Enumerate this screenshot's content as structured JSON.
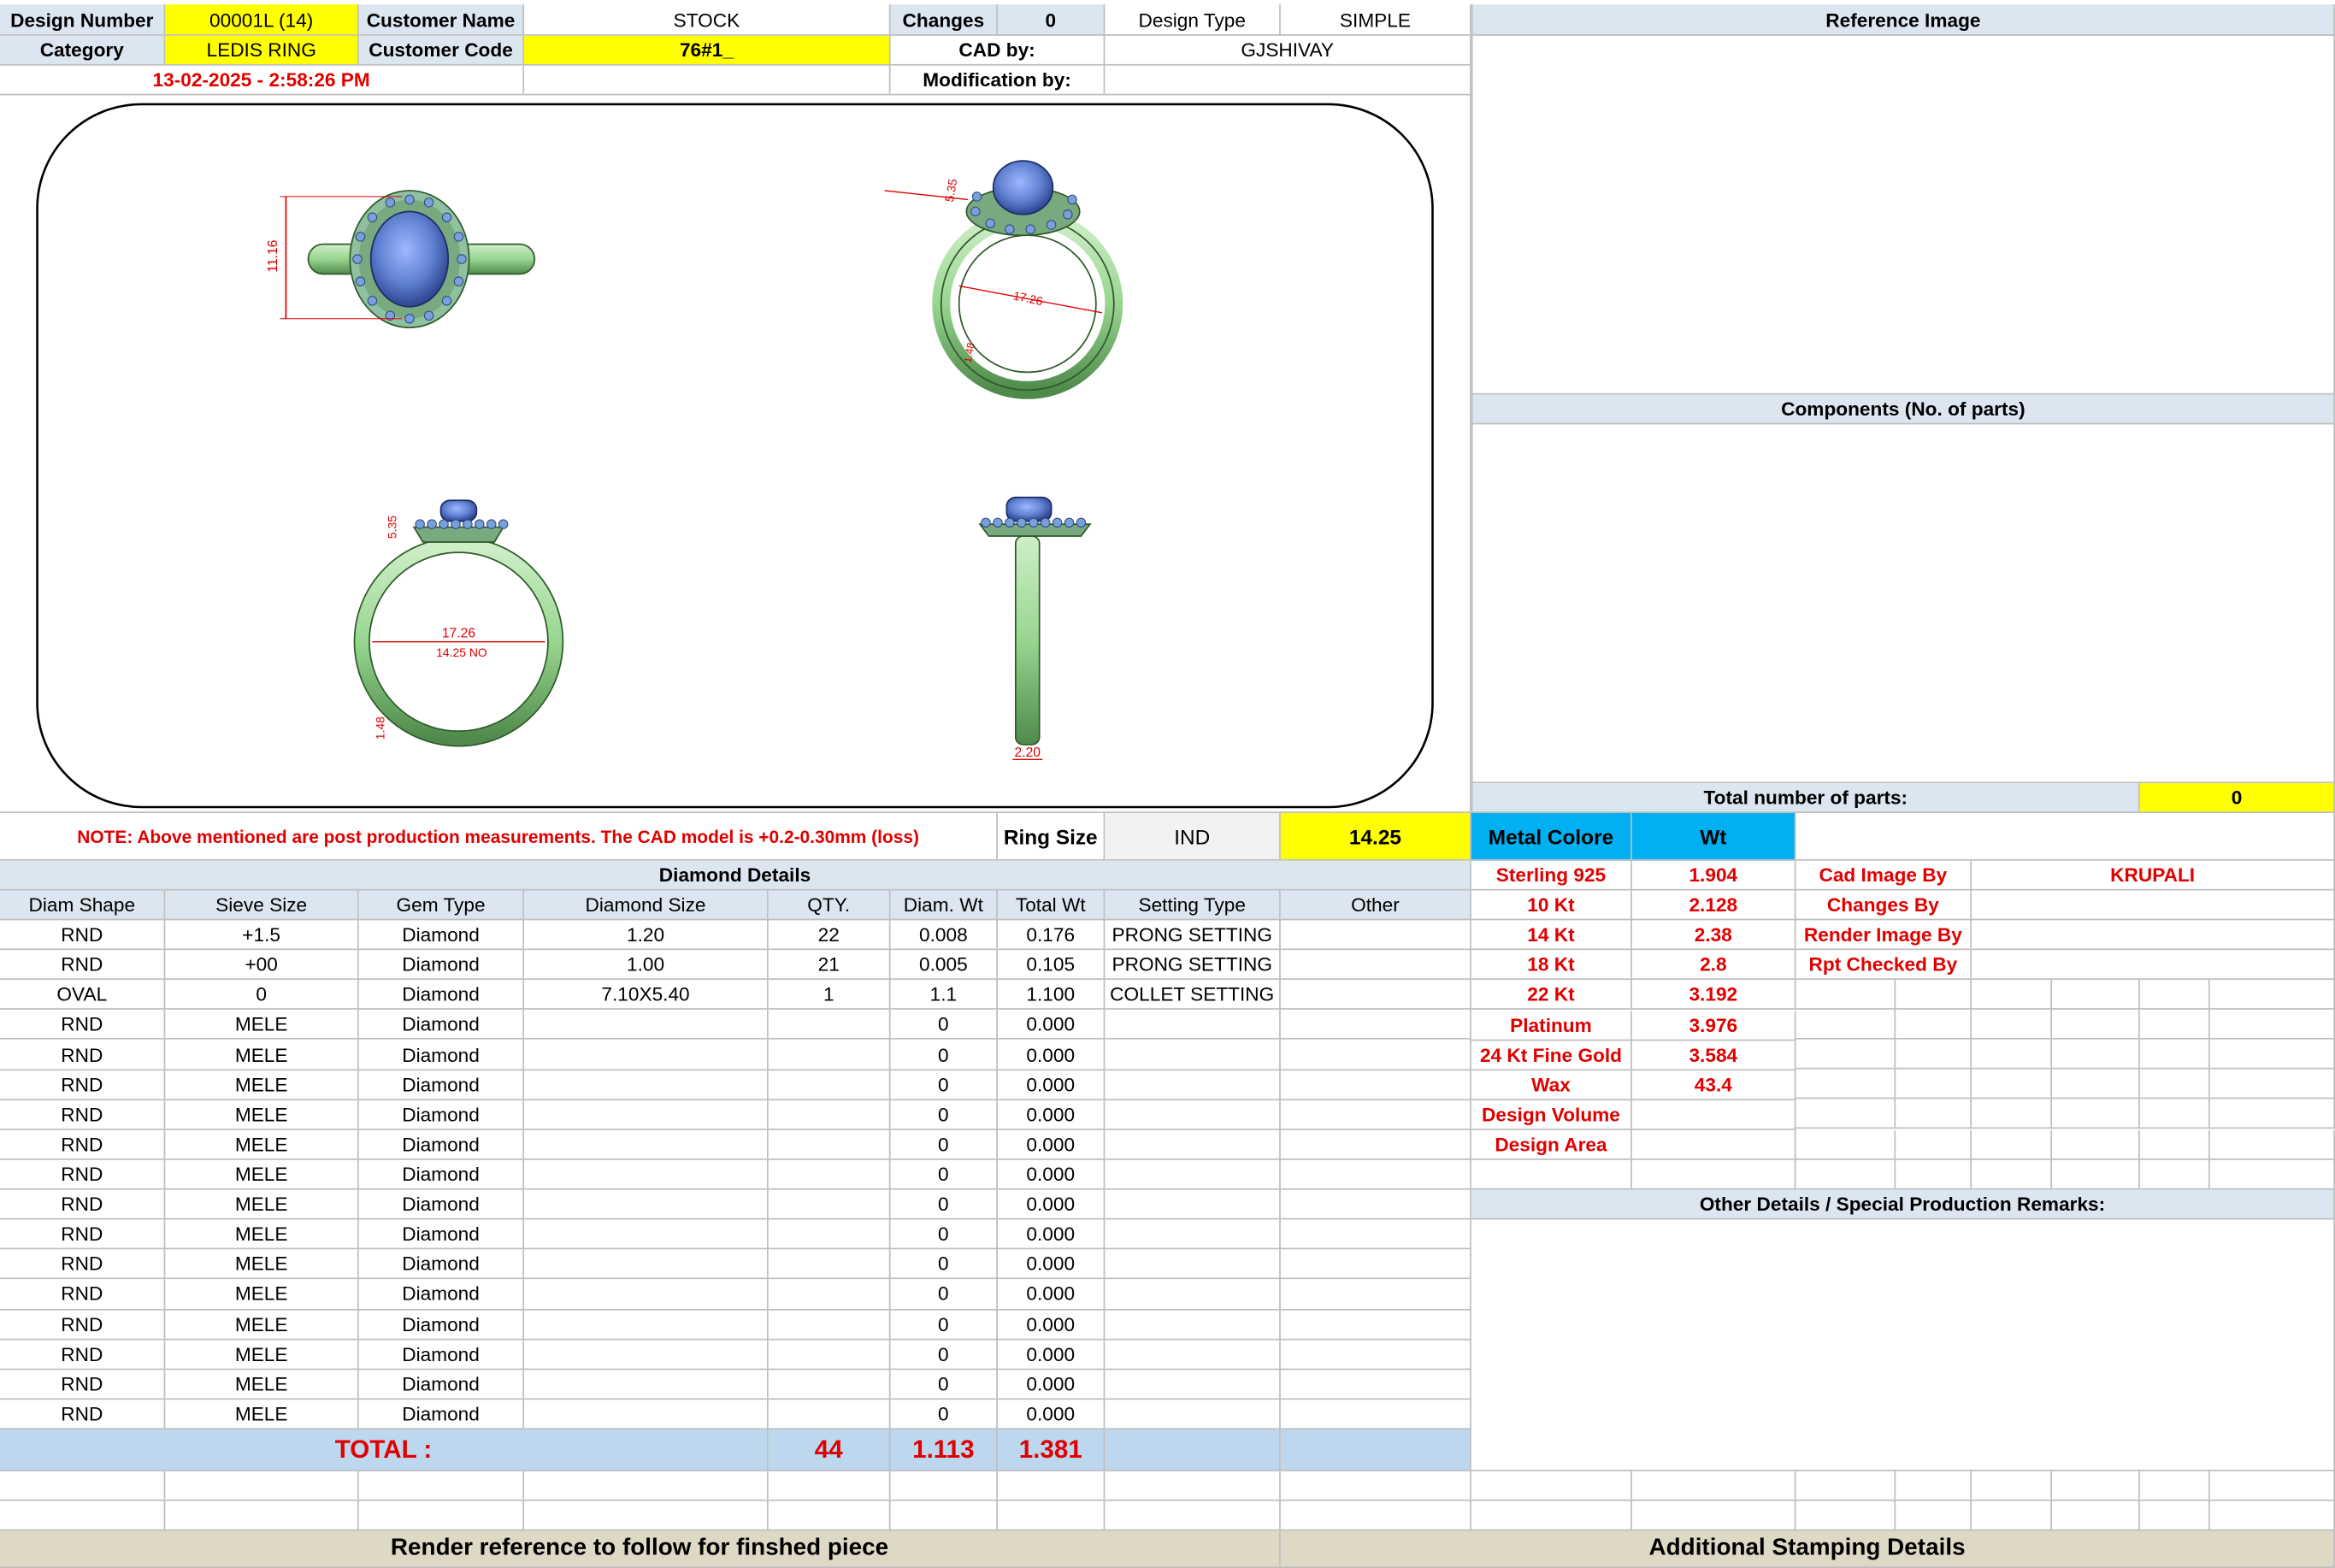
{
  "header": {
    "design_number_label": "Design Number",
    "design_number": "00001L (14)",
    "customer_name_label": "Customer Name",
    "customer_name": "STOCK",
    "changes_label": "Changes",
    "changes": "0",
    "design_type_label": "Design Type",
    "design_type": "SIMPLE",
    "category_label": "Category",
    "category": "LEDIS RING",
    "customer_code_label": "Customer Code",
    "customer_code": "76#1_",
    "cad_by_label": "CAD by:",
    "cad_by": "GJSHIVAY",
    "timestamp": "13-02-2025 - 2:58:26 PM",
    "modification_by_label": "Modification by:",
    "modification_by": ""
  },
  "reference_image_title": "Reference Image",
  "components_title": "Components (No. of parts)",
  "total_parts_label": "Total number of parts:",
  "total_parts": "0",
  "render_dims": {
    "top_left_height": "11.16",
    "top_right_height": "5.35",
    "top_right_diameter": "17.26",
    "top_right_band": "1.48",
    "bottom_left_height": "5.35",
    "bottom_left_diameter": "17.26",
    "bottom_left_size": "14.25 NO",
    "bottom_left_band": "1.48",
    "bottom_right_width": "2.20"
  },
  "note": "NOTE: Above mentioned are post production measurements. The CAD model is +0.2-0.30mm (loss)",
  "ring_size": {
    "label": "Ring Size",
    "standard": "IND",
    "value": "14.25"
  },
  "metal": {
    "color_label": "Metal Colore",
    "wt_label": "Wt",
    "rows": [
      {
        "name": "Sterling 925",
        "wt": "1.904"
      },
      {
        "name": "10 Kt",
        "wt": "2.128"
      },
      {
        "name": "14 Kt",
        "wt": "2.38"
      },
      {
        "name": "18 Kt",
        "wt": "2.8"
      },
      {
        "name": "22 Kt",
        "wt": "3.192"
      },
      {
        "name": "Platinum",
        "wt": "3.976"
      },
      {
        "name": "24 Kt Fine Gold",
        "wt": "3.584"
      },
      {
        "name": "Wax",
        "wt": "43.4"
      },
      {
        "name": "Design Volume",
        "wt": ""
      },
      {
        "name": "Design Area",
        "wt": ""
      }
    ]
  },
  "credits": [
    {
      "label": "Cad Image By",
      "value": "KRUPALI"
    },
    {
      "label": "Changes By",
      "value": ""
    },
    {
      "label": "Render Image By",
      "value": ""
    },
    {
      "label": "Rpt Checked By",
      "value": ""
    }
  ],
  "other_details_title": "Other Details / Special Production Remarks:",
  "diamond": {
    "title": "Diamond Details",
    "headers": [
      "Diam Shape",
      "Sieve Size",
      "Gem Type",
      "Diamond Size",
      "QTY.",
      "Diam. Wt",
      "Total Wt",
      "Setting Type",
      "Other"
    ],
    "rows": [
      [
        "RND",
        "+1.5",
        "Diamond",
        "1.20",
        "22",
        "0.008",
        "0.176",
        "PRONG SETTING",
        ""
      ],
      [
        "RND",
        "+00",
        "Diamond",
        "1.00",
        "21",
        "0.005",
        "0.105",
        "PRONG SETTING",
        ""
      ],
      [
        "OVAL",
        "0",
        "Diamond",
        "7.10X5.40",
        "1",
        "1.1",
        "1.100",
        "COLLET SETTING",
        ""
      ],
      [
        "RND",
        "MELE",
        "Diamond",
        "",
        "",
        "0",
        "0.000",
        "",
        ""
      ],
      [
        "RND",
        "MELE",
        "Diamond",
        "",
        "",
        "0",
        "0.000",
        "",
        ""
      ],
      [
        "RND",
        "MELE",
        "Diamond",
        "",
        "",
        "0",
        "0.000",
        "",
        ""
      ],
      [
        "RND",
        "MELE",
        "Diamond",
        "",
        "",
        "0",
        "0.000",
        "",
        ""
      ],
      [
        "RND",
        "MELE",
        "Diamond",
        "",
        "",
        "0",
        "0.000",
        "",
        ""
      ],
      [
        "RND",
        "MELE",
        "Diamond",
        "",
        "",
        "0",
        "0.000",
        "",
        ""
      ],
      [
        "RND",
        "MELE",
        "Diamond",
        "",
        "",
        "0",
        "0.000",
        "",
        ""
      ],
      [
        "RND",
        "MELE",
        "Diamond",
        "",
        "",
        "0",
        "0.000",
        "",
        ""
      ],
      [
        "RND",
        "MELE",
        "Diamond",
        "",
        "",
        "0",
        "0.000",
        "",
        ""
      ],
      [
        "RND",
        "MELE",
        "Diamond",
        "",
        "",
        "0",
        "0.000",
        "",
        ""
      ],
      [
        "RND",
        "MELE",
        "Diamond",
        "",
        "",
        "0",
        "0.000",
        "",
        ""
      ],
      [
        "RND",
        "MELE",
        "Diamond",
        "",
        "",
        "0",
        "0.000",
        "",
        ""
      ],
      [
        "RND",
        "MELE",
        "Diamond",
        "",
        "",
        "0",
        "0.000",
        "",
        ""
      ],
      [
        "RND",
        "MELE",
        "Diamond",
        "",
        "",
        "0",
        "0.000",
        "",
        ""
      ]
    ],
    "total_label": "TOTAL :",
    "total_qty": "44",
    "total_diam_wt": "1.113",
    "total_wt": "1.381"
  },
  "footer": {
    "left": "Render reference to follow for finshed piece",
    "right": "Additional Stamping Details"
  },
  "colors": {
    "label_bg": "#dce6f1",
    "highlight": "#ffff00",
    "metal_header": "#00b0f0",
    "footer_bg": "#ddd9c4",
    "metal_green": "#a8e0a0",
    "stone_blue": "#6f8fd8"
  }
}
